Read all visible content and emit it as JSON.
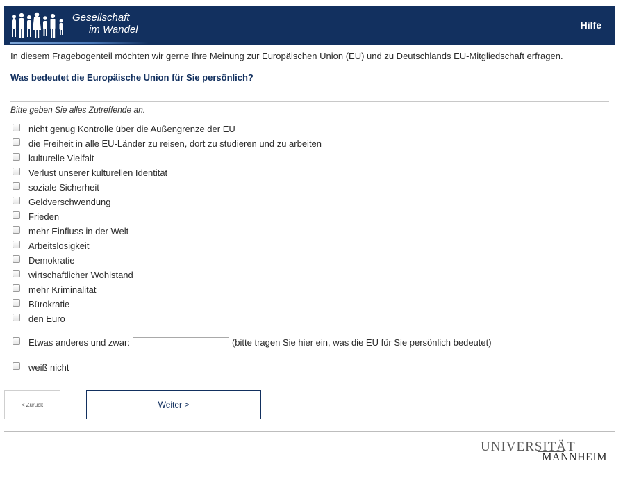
{
  "header": {
    "logo_line1": "Gesellschaft",
    "logo_line2": "im Wandel",
    "help_label": "Hilfe",
    "bg_color": "#12305f"
  },
  "intro": "In diesem Fragebogenteil möchten wir gerne Ihre Meinung zur Europäischen Union (EU) und zu Deutschlands EU-Mitgliedschaft erfragen.",
  "question": "Was bedeutet die Europäische Union für Sie persönlich?",
  "instruction": "Bitte geben Sie alles Zutreffende an.",
  "options": [
    "nicht genug Kontrolle über die Außengrenze der EU",
    "die Freiheit in alle EU-Länder zu reisen, dort zu studieren und zu arbeiten",
    "kulturelle Vielfalt",
    "Verlust unserer kulturellen Identität",
    "soziale Sicherheit",
    "Geldverschwendung",
    "Frieden",
    "mehr Einfluss in der Welt",
    "Arbeitslosigkeit",
    "Demokratie",
    "wirtschaftlicher Wohlstand",
    "mehr Kriminalität",
    "Bürokratie",
    "den Euro"
  ],
  "other": {
    "label": "Etwas anderes und zwar:",
    "value": "",
    "hint": "(bitte tragen Sie hier ein, was die EU für Sie persönlich bedeutet)"
  },
  "dont_know": "weiß nicht",
  "nav": {
    "back_label": "< Zurück",
    "next_label": "Weiter >"
  },
  "footer": {
    "logo_line1": "UNIVERSITÄT",
    "logo_line2": "MANNHEIM"
  }
}
